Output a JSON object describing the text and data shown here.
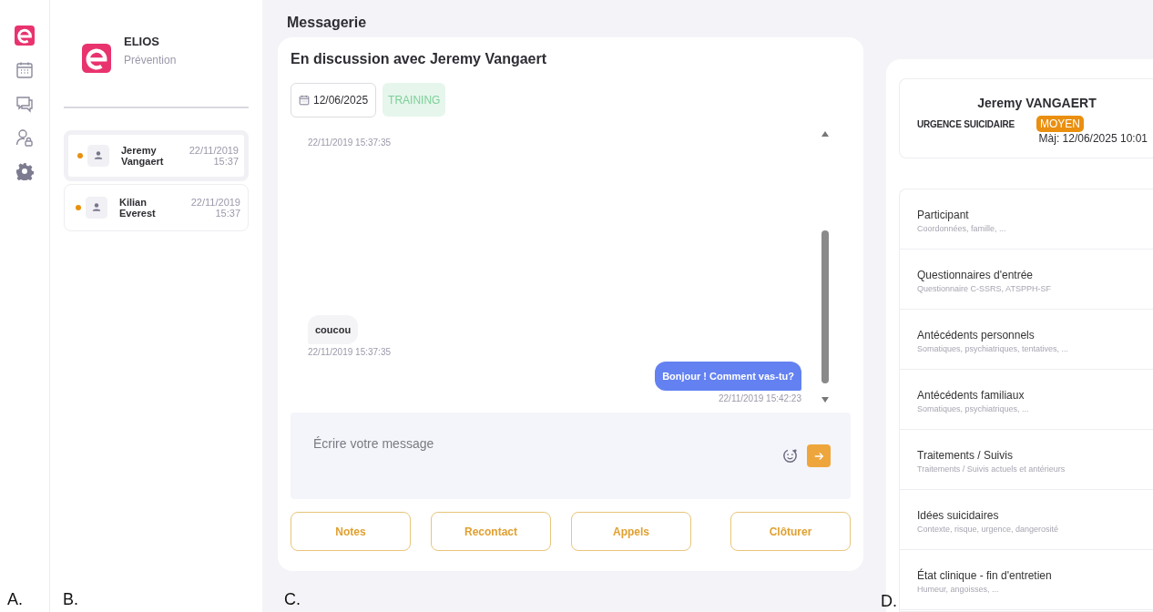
{
  "app": {
    "brand": "ELIOS",
    "subtitle": "Prévention"
  },
  "conversations": [
    {
      "first": "Jeremy",
      "last": "Vangaert",
      "date": "22/11/2019",
      "time": "15:37",
      "selected": true,
      "color": "#e8900f"
    },
    {
      "first": "Kilian",
      "last": "Everest",
      "date": "22/11/2019",
      "time": "15:37",
      "selected": false,
      "color": "#e8900f"
    }
  ],
  "page_title": "Messagerie",
  "chat": {
    "title": "En discussion avec Jeremy Vangaert",
    "date": "12/06/2025",
    "tag": "TRAINING",
    "messages": [
      {
        "kind": "time",
        "time": "22/11/2019 15:37:35"
      },
      {
        "kind": "received",
        "text": "coucou",
        "time": "22/11/2019 15:37:35"
      },
      {
        "kind": "sent",
        "text": "Bonjour ! Comment vas-tu?",
        "time": "22/11/2019 15:42:23"
      }
    ],
    "input": {
      "placeholder": "Écrire votre message"
    },
    "buttons": [
      "Notes",
      "Recontact",
      "Appels",
      "Clôturer"
    ]
  },
  "patient": {
    "name": "Jeremy VANGAERT",
    "risk_label": "URGENCE SUICIDAIRE",
    "risk_level": "MOYEN",
    "updated": "Màj: 12/06/2025 10:01"
  },
  "sections": [
    {
      "title": "Participant",
      "subtitle": "Coordonnées, famille, ..."
    },
    {
      "title": "Questionnaires d'entrée",
      "subtitle": "Questionnaire C-SSRS, ATSPPH-SF"
    },
    {
      "title": "Antécédents personnels",
      "subtitle": "Somatiques, psychiatriques, tentatives, ..."
    },
    {
      "title": "Antécédents familiaux",
      "subtitle": "Somatiques, psychiatriques, ..."
    },
    {
      "title": "Traitements / Suivis",
      "subtitle": "Traitements / Suivis actuels et antérieurs"
    },
    {
      "title": "Idées suicidaires",
      "subtitle": "Contexte, risque, urgence, dangerosité"
    },
    {
      "title": "État clinique - fin d'entretien",
      "subtitle": "Humeur, angoisses, ..."
    }
  ],
  "panel_labels": [
    "A.",
    "B.",
    "C.",
    "D."
  ]
}
